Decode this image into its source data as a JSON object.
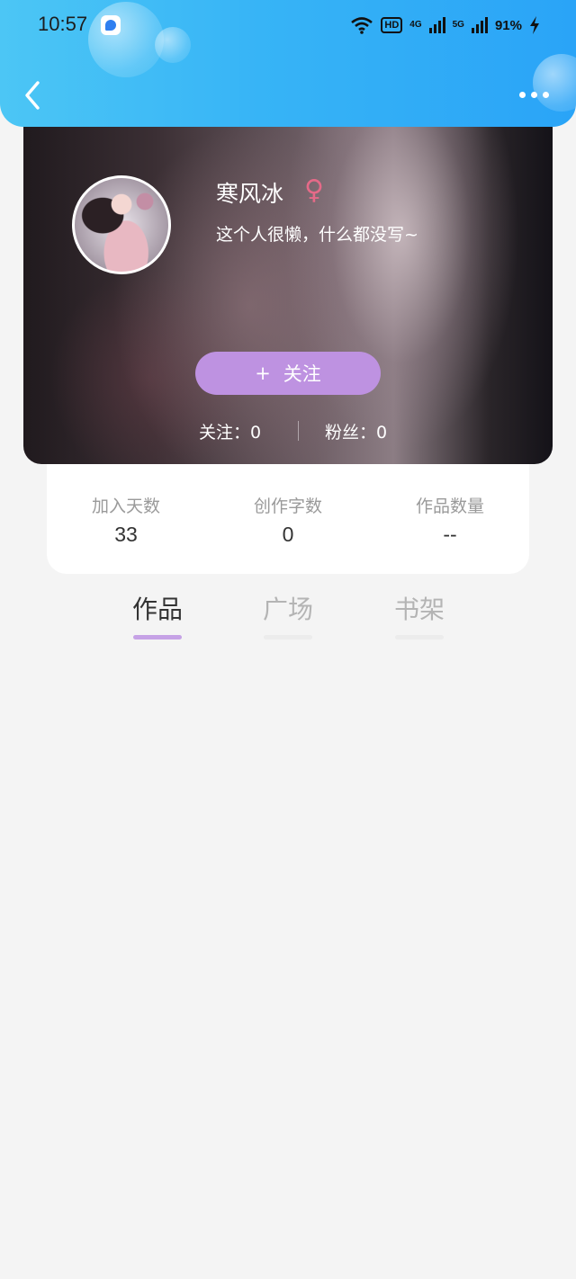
{
  "status_bar": {
    "time": "10:57",
    "hd_label": "HD",
    "net1": "4G",
    "net2": "5G",
    "battery": "91%"
  },
  "header": {
    "back_icon": "chevron-left-icon",
    "more_icon": "more-dots-icon"
  },
  "profile": {
    "nickname": "寒风冰",
    "gender_symbol": "♀",
    "bio": "这个人很懒，什么都没写~",
    "follow_plus": "+",
    "follow_label": "关注",
    "following": "关注：0",
    "fans": "粉丝：0"
  },
  "stats": [
    {
      "label": "加入天数",
      "value": "33"
    },
    {
      "label": "创作字数",
      "value": "0"
    },
    {
      "label": "作品数量",
      "value": "--"
    }
  ],
  "tabs": [
    {
      "label": "作品",
      "active": true
    },
    {
      "label": "广场",
      "active": false
    },
    {
      "label": "书架",
      "active": false
    }
  ],
  "colors": {
    "header_blue": "#37b4f6",
    "accent_purple": "#be92e1",
    "gender_pink": "#e56a88",
    "page_bg": "#f4f4f4"
  }
}
